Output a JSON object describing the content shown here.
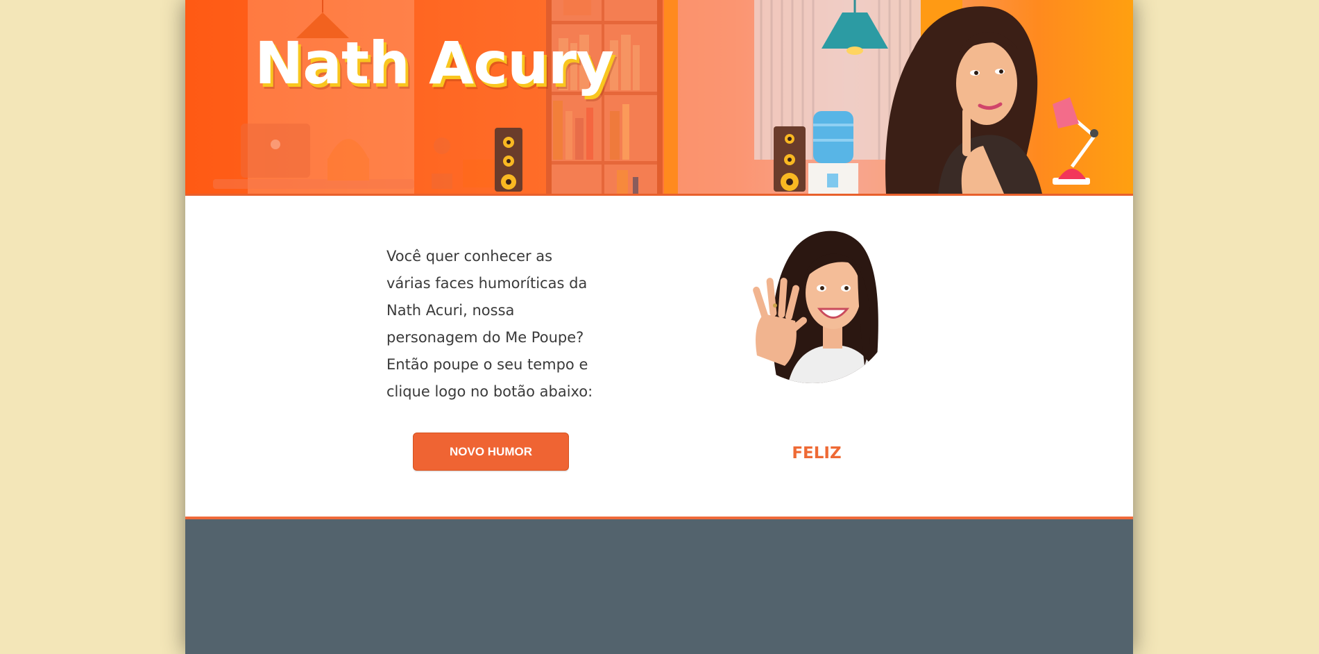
{
  "banner": {
    "title": "Nath Acury"
  },
  "intro": {
    "text": "Você quer conhecer as várias faces humoríticas da Nath Acuri, nossa personagem do Me Poupe? Então poupe o seu tempo e clique logo no botão abaixo:"
  },
  "actions": {
    "new_mood_label": "NOVO HUMOR"
  },
  "mood": {
    "current_label": "FELIZ"
  },
  "colors": {
    "accent": "#ef6433",
    "page_background": "#f3e6b8",
    "footer": "#53636d"
  }
}
